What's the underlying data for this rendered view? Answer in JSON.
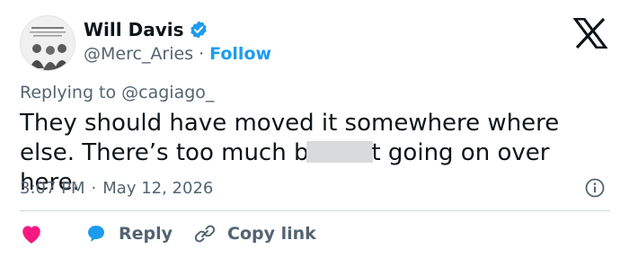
{
  "author": {
    "name": "Will Davis",
    "handle": "@Merc_Aries",
    "separator": "·",
    "follow_label": "Follow",
    "verified": true
  },
  "reply_context": {
    "text": "Replying to @cagiago_"
  },
  "tweet": {
    "text_before": "They should have moved it somewhere where else. There’s too much b",
    "text_after": "t going on over here."
  },
  "meta": {
    "time": "3:07 PM",
    "separator": "·",
    "date": "May 12, 2026"
  },
  "actions": {
    "like_label": "",
    "reply_label": "Reply",
    "copy_link_label": "Copy link"
  },
  "icons": {
    "platform": "x-logo-icon",
    "verified": "verified-badge-icon",
    "info": "info-icon",
    "like": "heart-icon",
    "reply": "speech-bubble-icon",
    "copy": "link-icon"
  },
  "colors": {
    "accent": "#1d9bf0",
    "like": "#f91880",
    "muted": "#536471",
    "text": "#0f1419"
  }
}
